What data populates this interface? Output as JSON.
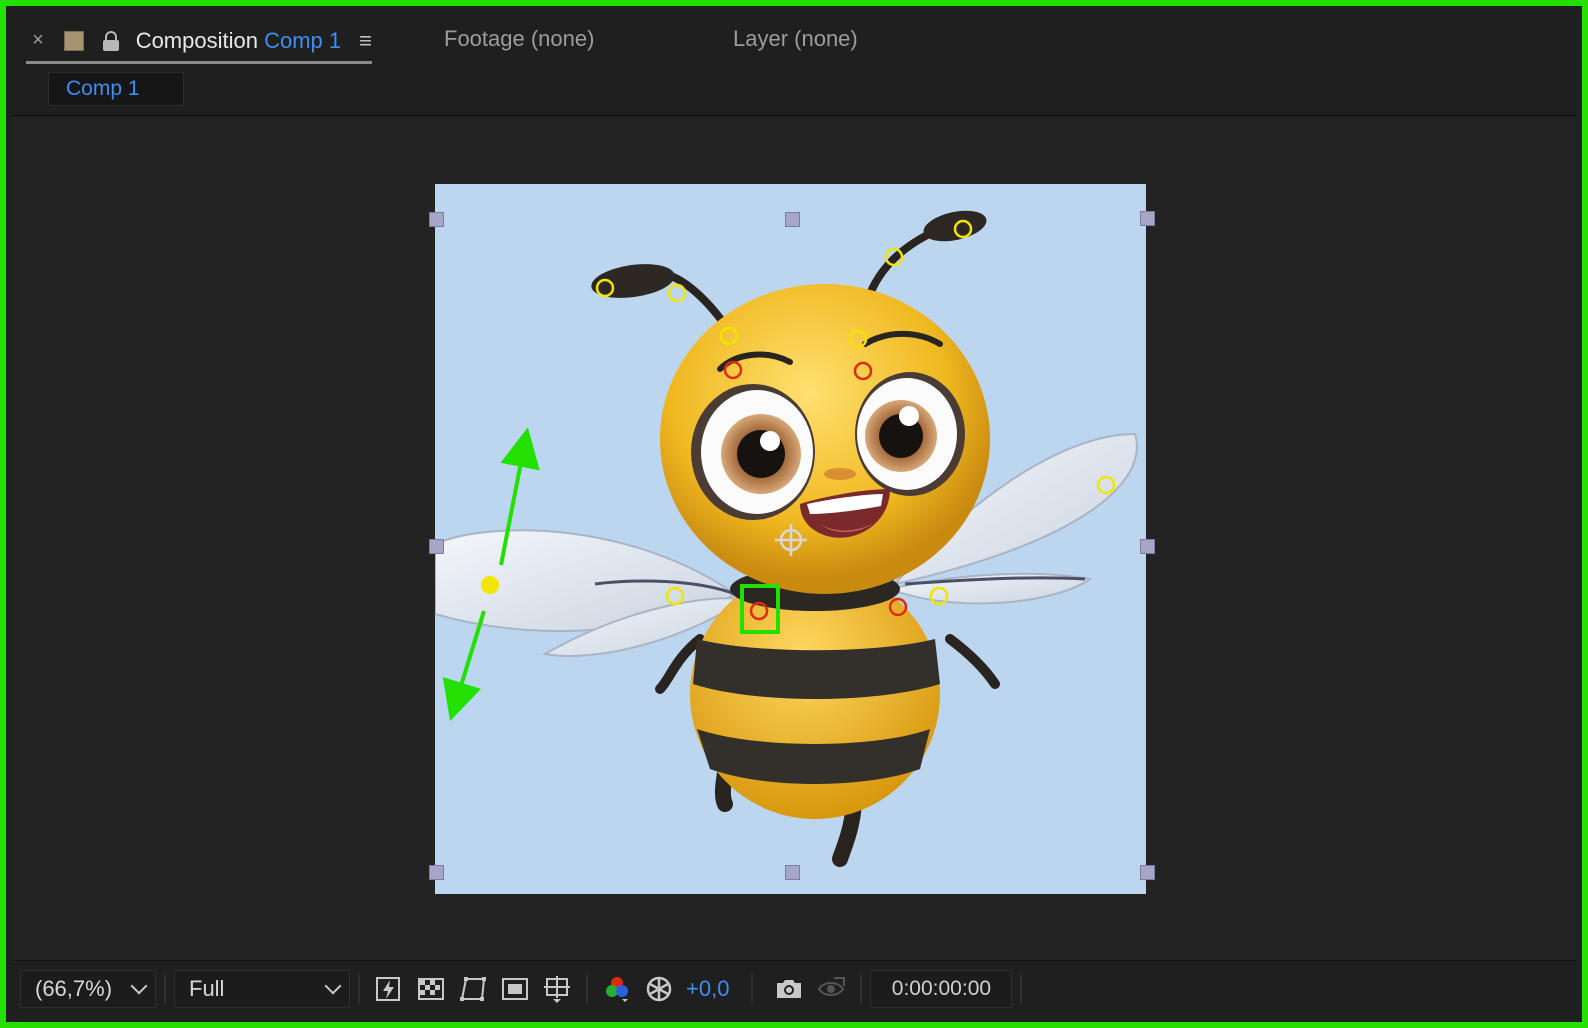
{
  "header": {
    "close_glyph": "×",
    "composition_label": "Composition",
    "comp_name": "Comp 1",
    "menu_glyph": "≡",
    "footage_tab": "Footage (none)",
    "layer_tab": "Layer (none)"
  },
  "subbar": {
    "comp_chip": "Comp 1"
  },
  "toolbar": {
    "zoom": "(66,7%)",
    "resolution": "Full",
    "exposure": "+0,0",
    "timecode": "0:00:00:00"
  },
  "colors": {
    "highlight_green": "#22e000",
    "accent_blue": "#3d8ef0",
    "pin_yellow": "#f2e600",
    "pin_red": "#e02a10",
    "label_swatch": "#a79272",
    "canvas_bg": "#bcd6f0"
  },
  "icons": [
    "close-icon",
    "label-swatch-icon",
    "lock-icon",
    "panel-menu-icon",
    "fast-previews-icon",
    "transparency-grid-icon",
    "mask-visibility-icon",
    "region-of-interest-icon",
    "grid-guides-icon",
    "channel-icon",
    "exposure-reset-icon",
    "snapshot-camera-icon",
    "show-snapshot-icon",
    "anchor-point-icon",
    "puppet-pin-icon",
    "drag-arrow-icon"
  ]
}
